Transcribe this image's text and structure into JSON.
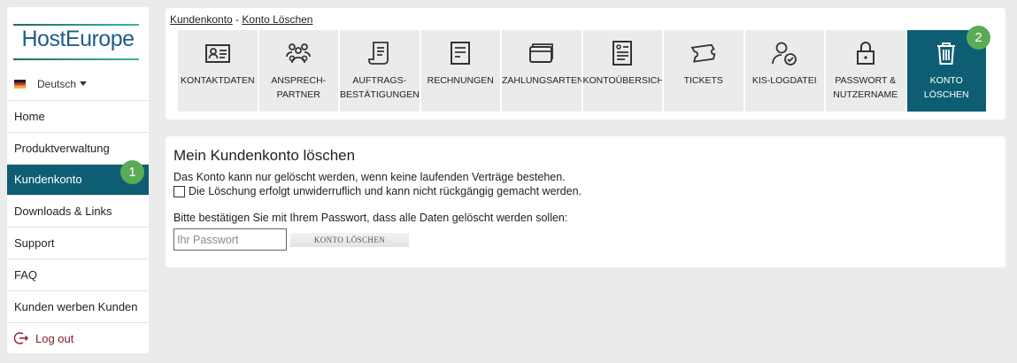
{
  "sidebar": {
    "logo": "HostEurope",
    "language": "Deutsch",
    "items": [
      {
        "label": "Home"
      },
      {
        "label": "Produktverwaltung"
      },
      {
        "label": "Kundenkonto"
      },
      {
        "label": "Downloads & Links"
      },
      {
        "label": "Support"
      },
      {
        "label": "FAQ"
      },
      {
        "label": "Kunden werben Kunden"
      },
      {
        "label": "Log out"
      }
    ]
  },
  "badges": {
    "one": "1",
    "two": "2"
  },
  "breadcrumb": {
    "root": "Kundenkonto",
    "sep": " - ",
    "current": "Konto Löschen"
  },
  "tabs": [
    {
      "label": "KONTAKTDATEN",
      "icon": "contact-card-icon"
    },
    {
      "label": "ANSPRECH-\nPARTNER",
      "icon": "people-group-icon"
    },
    {
      "label": "AUFTRAGS-\nBESTÄTIGUNGEN",
      "icon": "document-scroll-icon"
    },
    {
      "label": "RECHNUNGEN",
      "icon": "invoice-icon"
    },
    {
      "label": "ZAHLUNGSARTEN",
      "icon": "wallet-icon"
    },
    {
      "label": "KONTOÜBERSICHT",
      "icon": "account-overview-icon"
    },
    {
      "label": "TICKETS",
      "icon": "ticket-icon"
    },
    {
      "label": "KIS-LOGDATEI",
      "icon": "user-check-icon"
    },
    {
      "label": "PASSWORT &\nNUTZERNAME",
      "icon": "lock-icon"
    },
    {
      "label": "KONTO LÖSCHEN",
      "icon": "trash-icon"
    }
  ],
  "main": {
    "title": "Mein Kundenkonto löschen",
    "info": "Das Konto kann nur gelöscht werden, wenn keine laufenden Verträge bestehen.",
    "checkbox_label": "Die Löschung erfolgt unwiderruflich und kann nicht rückgängig gemacht werden.",
    "confirm_text": "Bitte bestätigen Sie mit Ihrem Passwort, dass alle Daten gelöscht werden sollen:",
    "password_placeholder": "Ihr Passwort",
    "delete_button": "KONTO LÖSCHEN"
  },
  "colors": {
    "accent": "#0e5e73",
    "badge": "#5aab55",
    "logout": "#8a1c2b"
  }
}
